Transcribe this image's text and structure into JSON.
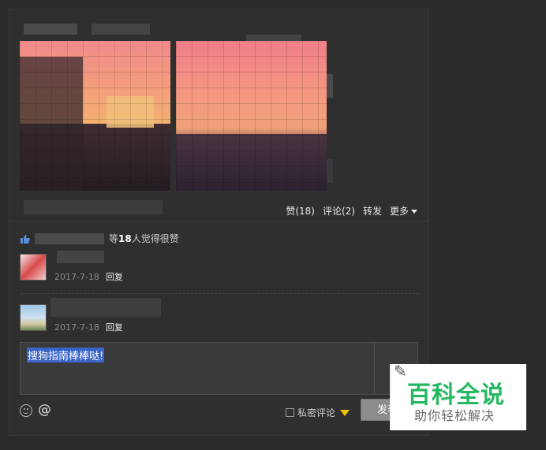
{
  "post": {
    "actions": {
      "like": "赞(18)",
      "comment": "评论(2)",
      "forward": "转发",
      "more": "更多"
    },
    "likes_text_pre": "等",
    "likes_count": "18",
    "likes_text_post": "人觉得很赞"
  },
  "comments": [
    {
      "date": "2017-7-18",
      "reply": "回复"
    },
    {
      "date": "2017-7-18",
      "reply": "回复"
    }
  ],
  "editor": {
    "value": "搜狗指南棒棒哒!",
    "private_label": "私密评论",
    "send_label": "发表"
  },
  "watermark": {
    "main": "百科全说",
    "sub": "助你轻松解决"
  },
  "colors": {
    "background": "#2b2b2b",
    "card": "#2f2f2f",
    "selection": "#3b64c8",
    "gem": "#f2c200",
    "watermark_green": "#25b861"
  }
}
